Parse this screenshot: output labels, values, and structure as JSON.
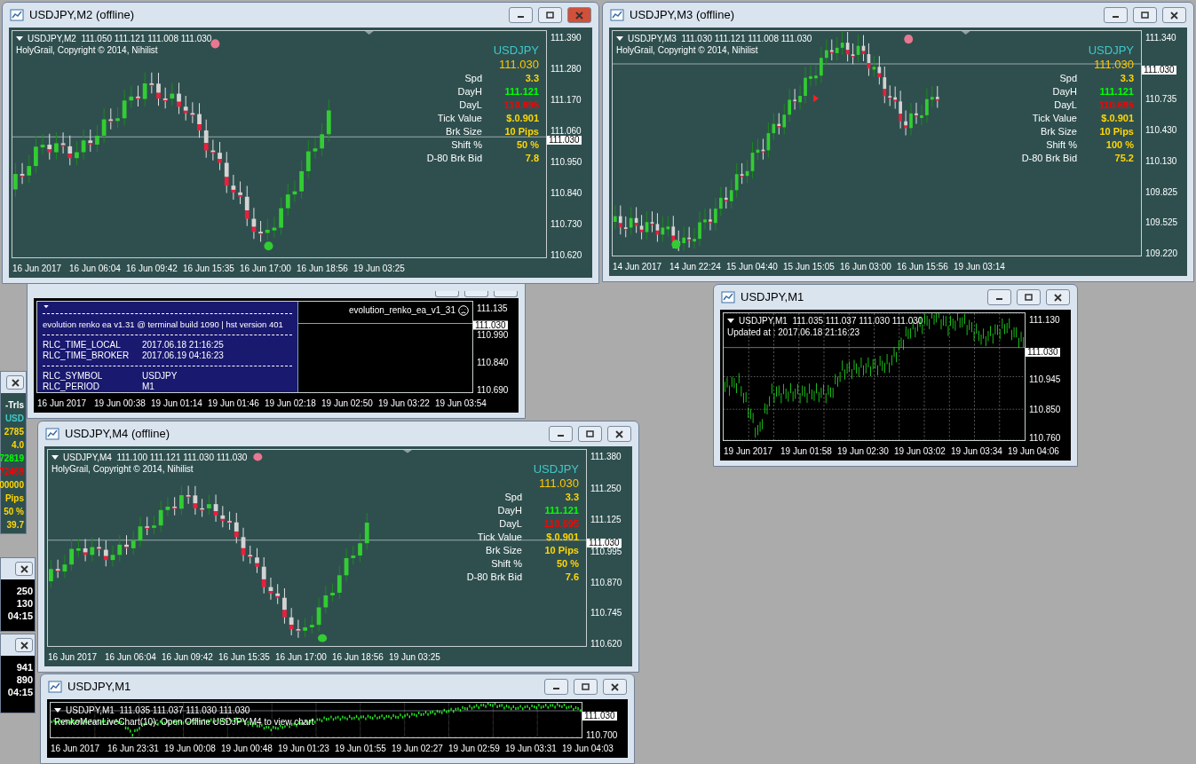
{
  "windows": [
    {
      "kind": "renko",
      "title": "USDJPY,M2 (offline)",
      "active": true,
      "legend": "USDJPY,M2  111.050 111.121 111.008 111.030",
      "note": "HolyGrail, Copyright © 2014, Nihilist",
      "info": {
        "symbol": "USDJPY",
        "price": "111.030",
        "rows": [
          {
            "label": "Spd",
            "value": "3.3",
            "color": "#ffd700"
          },
          {
            "label": "DayH",
            "value": "111.121",
            "color": "#00ff00"
          },
          {
            "label": "DayL",
            "value": "110.695",
            "color": "#ff0000"
          },
          {
            "label": "Tick Value",
            "value": "$.0.901",
            "color": "#ffd700"
          },
          {
            "label": "Brk Size",
            "value": "10 Pips",
            "color": "#ffd700"
          },
          {
            "label": "Shift %",
            "value": "50 %",
            "color": "#ffd700"
          },
          {
            "label": "D-80 Brk Bid",
            "value": "7.8",
            "color": "#ffd700"
          }
        ]
      },
      "price_ticks": [
        "111.390",
        "111.280",
        "111.170",
        "111.060",
        "110.950",
        "110.840",
        "110.730",
        "110.620"
      ],
      "current_price": "111.030",
      "time_labels": [
        "16 Jun 2017",
        "16 Jun 06:04",
        "16 Jun 09:42",
        "16 Jun 15:35",
        "16 Jun 17:00",
        "16 Jun 18:56",
        "19 Jun 03:25"
      ]
    },
    {
      "kind": "renko",
      "title": "USDJPY,M3 (offline)",
      "active": false,
      "legend": "USDJPY,M3  111.030 111.121 111.008 111.030",
      "note": "HolyGrail, Copyright © 2014, Nihilist",
      "info": {
        "symbol": "USDJPY",
        "price": "111.030",
        "rows": [
          {
            "label": "Spd",
            "value": "3.3",
            "color": "#ffd700"
          },
          {
            "label": "DayH",
            "value": "111.121",
            "color": "#00ff00"
          },
          {
            "label": "DayL",
            "value": "110.695",
            "color": "#ff0000"
          },
          {
            "label": "Tick Value",
            "value": "$.0.901",
            "color": "#ffd700"
          },
          {
            "label": "Brk Size",
            "value": "10 Pips",
            "color": "#ffd700"
          },
          {
            "label": "Shift %",
            "value": "100 %",
            "color": "#ffd700"
          },
          {
            "label": "D-80 Brk Bid",
            "value": "75.2",
            "color": "#ffd700"
          }
        ]
      },
      "price_ticks": [
        "111.340",
        "110.735",
        "110.430",
        "110.130",
        "109.825",
        "109.525",
        "109.220"
      ],
      "current_price": "111.030",
      "time_labels": [
        "14 Jun 2017",
        "14 Jun 22:24",
        "15 Jun 04:40",
        "15 Jun 15:05",
        "16 Jun 03:00",
        "16 Jun 15:56",
        "19 Jun 03:14"
      ]
    },
    {
      "kind": "evolution",
      "active": false,
      "label": "evolution_renko_ea_v1_31",
      "lines": [
        {
          "kind": "rule"
        },
        {
          "kind": "heading",
          "text": "evolution renko ea v1.31 @ terminal build 1090 | hst version 401"
        },
        {
          "kind": "rule"
        },
        {
          "kind": "pair",
          "key": "RLC_TIME_LOCAL",
          "value": "2017.06.18 21:16:25"
        },
        {
          "kind": "pair",
          "key": "RLC_TIME_BROKER",
          "value": "2017.06.19 04:16:23"
        },
        {
          "kind": "rule"
        },
        {
          "kind": "pair",
          "key": "RLC_SYMBOL",
          "value": "USDJPY"
        },
        {
          "kind": "pair",
          "key": "RLC_PERIOD",
          "value": "M1"
        }
      ],
      "price_ticks": [
        "111.135",
        "110.990",
        "110.840",
        "110.690"
      ],
      "current_price": "111.030",
      "time_labels": [
        "16 Jun 2017",
        "19 Jun 00:38",
        "19 Jun 01:14",
        "19 Jun 01:46",
        "19 Jun 02:18",
        "19 Jun 02:50",
        "19 Jun 03:22",
        "19 Jun 03:54"
      ]
    },
    {
      "kind": "bars",
      "title": "USDJPY,M1",
      "active": false,
      "legend": "USDJPY,M1  111.035 111.037 111.030 111.030",
      "note": "Updated at : 2017.06.18 21:16:23",
      "price_ticks": [
        "111.130",
        "110.945",
        "110.850",
        "110.760"
      ],
      "current_price": "111.030",
      "time_labels": [
        "19 Jun 2017",
        "19 Jun 01:58",
        "19 Jun 02:30",
        "19 Jun 03:02",
        "19 Jun 03:34",
        "19 Jun 04:06"
      ]
    },
    {
      "kind": "renko",
      "title": "USDJPY,M4 (offline)",
      "active": false,
      "legend": "USDJPY,M4  111.100 111.121 111.030 111.030",
      "note": "HolyGrail, Copyright © 2014, Nihilist",
      "info": {
        "symbol": "USDJPY",
        "price": "111.030",
        "rows": [
          {
            "label": "Spd",
            "value": "3.3",
            "color": "#ffd700"
          },
          {
            "label": "DayH",
            "value": "111.121",
            "color": "#00ff00"
          },
          {
            "label": "DayL",
            "value": "110.695",
            "color": "#ff0000"
          },
          {
            "label": "Tick Value",
            "value": "$.0.901",
            "color": "#ffd700"
          },
          {
            "label": "Brk Size",
            "value": "10 Pips",
            "color": "#ffd700"
          },
          {
            "label": "Shift %",
            "value": "50 %",
            "color": "#ffd700"
          },
          {
            "label": "D-80 Brk Bid",
            "value": "7.6",
            "color": "#ffd700"
          }
        ]
      },
      "price_ticks": [
        "111.380",
        "111.250",
        "111.125",
        "110.995",
        "110.870",
        "110.745",
        "110.620"
      ],
      "current_price": "111.030",
      "time_labels": [
        "16 Jun 2017",
        "16 Jun 06:04",
        "16 Jun 09:42",
        "16 Jun 15:35",
        "16 Jun 17:00",
        "16 Jun 18:56",
        "19 Jun 03:25"
      ]
    },
    {
      "kind": "bars",
      "title": "USDJPY,M1",
      "active": false,
      "legend": "USDJPY,M1  111.035 111.037 111.030 111.030",
      "note": "RenkoMeanLiveChart(10): Open Offline USDJPY,M4 to view chart",
      "price_ticks": [
        "110.700"
      ],
      "current_price": "111.030",
      "time_labels": [
        "16 Jun 2017",
        "16 Jun 23:31",
        "19 Jun 00:08",
        "19 Jun 00:48",
        "19 Jun 01:23",
        "19 Jun 01:55",
        "19 Jun 02:27",
        "19 Jun 02:59",
        "19 Jun 03:31",
        "19 Jun 04:03"
      ]
    }
  ],
  "background_windows": [
    {
      "kind": "info",
      "texts": [
        {
          "text": "-Trls",
          "color": "#ffffff"
        },
        {
          "text": "USD",
          "color": "#40c8c8"
        },
        {
          "text": "2785",
          "color": "#ffd700"
        },
        {
          "text": "4.0",
          "color": "#ffd700"
        },
        {
          "text": "72819",
          "color": "#00ff00"
        },
        {
          "text": "72469",
          "color": "#ff0000"
        },
        {
          "text": "00000",
          "color": "#ffd700"
        },
        {
          "text": "Pips",
          "color": "#ffd700"
        },
        {
          "text": "50 %",
          "color": "#ffd700"
        },
        {
          "text": "39.7",
          "color": "#ffd700"
        }
      ]
    },
    {
      "kind": "axis",
      "texts": [
        {
          "text": "250",
          "color": "#ffffff"
        },
        {
          "text": "130",
          "color": "#ffffff"
        },
        {
          "text": "04:15",
          "color": "#ffffff"
        }
      ]
    },
    {
      "kind": "axis",
      "texts": [
        {
          "text": "941",
          "color": "#ffffff"
        },
        {
          "text": "890",
          "color": "#ffffff"
        },
        {
          "text": "04:15",
          "color": "#ffffff"
        }
      ]
    }
  ]
}
